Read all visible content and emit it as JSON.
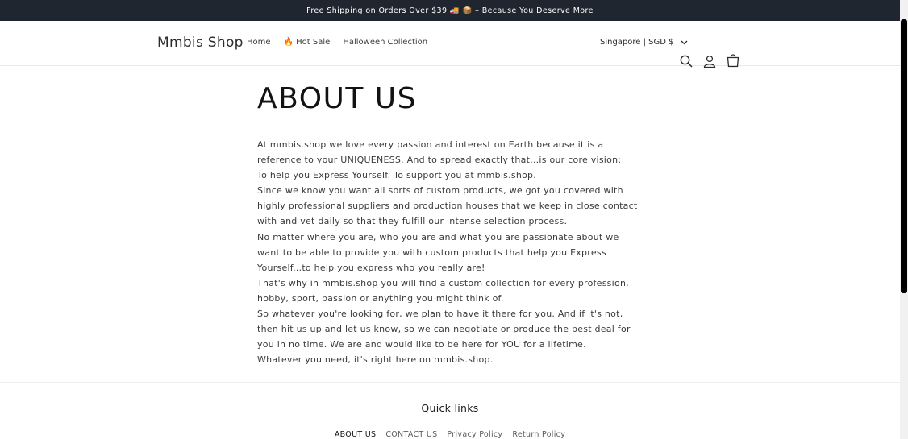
{
  "announcement": {
    "text": "Free Shipping on Orders Over  $39 🚚 📦 – Because You Deserve More"
  },
  "header": {
    "logo": "Mmbis Shop",
    "nav": [
      {
        "label": "Home"
      },
      {
        "label": "🔥 Hot Sale"
      },
      {
        "label": "Halloween Collection"
      }
    ],
    "region": "Singapore | SGD $",
    "icons": [
      "search-icon",
      "account-icon",
      "cart-icon"
    ]
  },
  "main": {
    "title": "ABOUT US",
    "paragraphs": [
      "At mmbis.shop we love every passion and interest on Earth because it is a reference to your UNIQUENESS. And to spread exactly that...is our core vision:",
      "To help you Express Yourself. To support you at mmbis.shop.",
      "Since we know you want all sorts of custom products, we got you covered with highly professional suppliers and production houses that we keep in close contact with and vet daily so that they fulfill our intense selection process.",
      "No matter where you are, who you are and what you are passionate about we want to be able to provide you with custom products that help you Express Yourself...to help you express who you really are!",
      "That's why in mmbis.shop you will find a custom collection for every profession, hobby, sport, passion or anything you might think of.",
      "So whatever you're looking for, we plan to have it there for you. And if it's not, then hit us up and let us know, so we can negotiate or produce the best deal for you in no time. We are and would like to be here for YOU for a lifetime.",
      "Whatever you need, it's right here on mmbis.shop."
    ]
  },
  "footer": {
    "title": "Quick links",
    "links": [
      {
        "label": "ABOUT US"
      },
      {
        "label": "CONTACT US"
      },
      {
        "label": "Privacy Policy"
      },
      {
        "label": "Return Policy"
      }
    ]
  },
  "colors": {
    "announcement_bg": "#1f2630",
    "text": "#121212",
    "body_text": "#3a3a3a"
  }
}
